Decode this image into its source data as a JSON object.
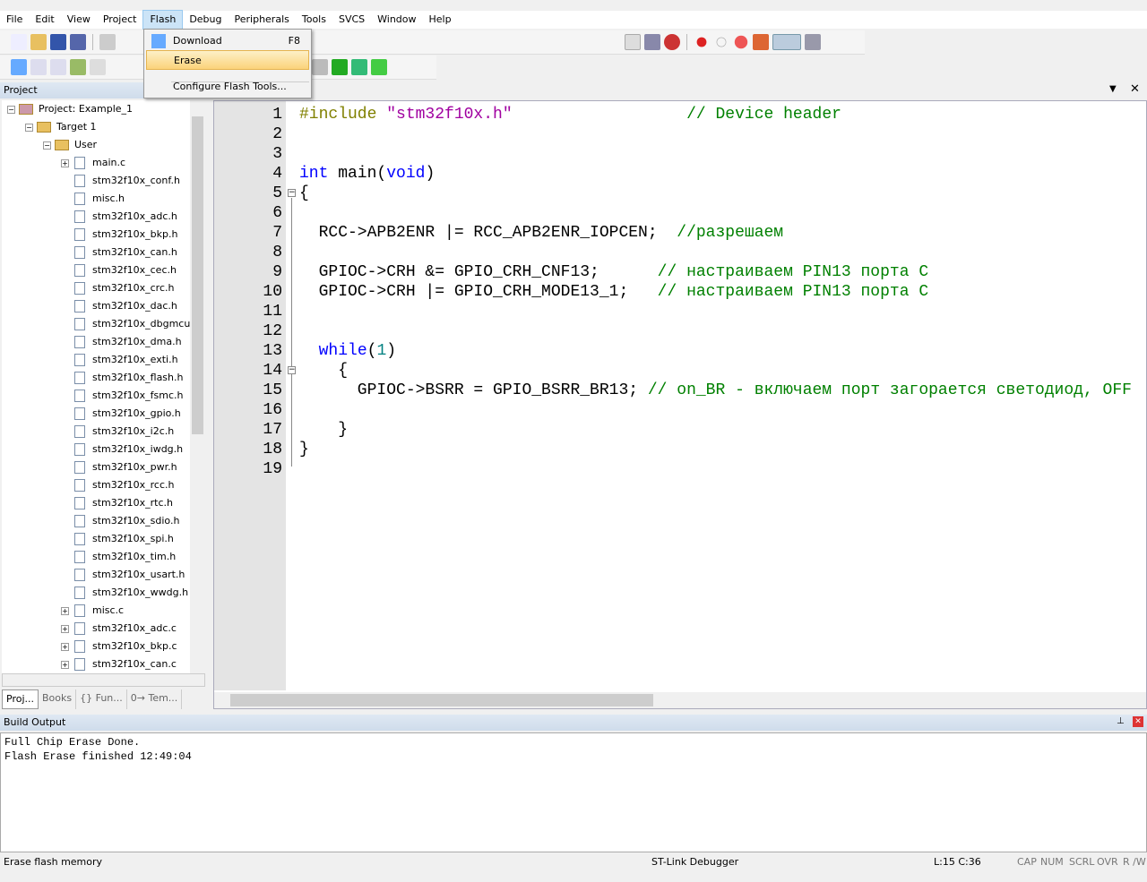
{
  "menubar": [
    "File",
    "Edit",
    "View",
    "Project",
    "Flash",
    "Debug",
    "Peripherals",
    "Tools",
    "SVCS",
    "Window",
    "Help"
  ],
  "flash_menu": {
    "items": [
      {
        "label": "Download",
        "shortcut": "F8",
        "icon": "load-icon"
      },
      {
        "label": "Erase",
        "highlighted": true
      },
      {
        "label": "Configure Flash Tools..."
      }
    ]
  },
  "project_panel": {
    "title": "Project",
    "root": "Project: Example_1",
    "target": "Target 1",
    "group": "User",
    "files": [
      "main.c",
      "stm32f10x_conf.h",
      "misc.h",
      "stm32f10x_adc.h",
      "stm32f10x_bkp.h",
      "stm32f10x_can.h",
      "stm32f10x_cec.h",
      "stm32f10x_crc.h",
      "stm32f10x_dac.h",
      "stm32f10x_dbgmcu.",
      "stm32f10x_dma.h",
      "stm32f10x_exti.h",
      "stm32f10x_flash.h",
      "stm32f10x_fsmc.h",
      "stm32f10x_gpio.h",
      "stm32f10x_i2c.h",
      "stm32f10x_iwdg.h",
      "stm32f10x_pwr.h",
      "stm32f10x_rcc.h",
      "stm32f10x_rtc.h",
      "stm32f10x_sdio.h",
      "stm32f10x_spi.h",
      "stm32f10x_tim.h",
      "stm32f10x_usart.h",
      "stm32f10x_wwdg.h",
      "misc.c",
      "stm32f10x_adc.c",
      "stm32f10x_bkp.c",
      "stm32f10x_can.c"
    ],
    "expandable": [
      0,
      25,
      26,
      27,
      28
    ],
    "tabs": [
      "Proj...",
      "Books",
      "{} Fun...",
      "0→ Tem..."
    ]
  },
  "editor": {
    "lines": [
      [
        [
          "pp",
          "#include "
        ],
        [
          "str",
          "\"stm32f10x.h\""
        ],
        [
          "",
          "                  "
        ],
        [
          "cm",
          "// Device header"
        ]
      ],
      [],
      [],
      [
        [
          "kw",
          "int"
        ],
        [
          "",
          " main("
        ],
        [
          "kw",
          "void"
        ],
        [
          "",
          ")"
        ]
      ],
      [
        [
          "",
          "{"
        ]
      ],
      [],
      [
        [
          "",
          "  RCC->APB2ENR |= RCC_APB2ENR_IOPCEN;  "
        ],
        [
          "cm",
          "//разрешаем"
        ]
      ],
      [],
      [
        [
          "",
          "  GPIOC->CRH &= GPIO_CRH_CNF13;      "
        ],
        [
          "cm",
          "// настраиваем PIN13 порта C"
        ]
      ],
      [
        [
          "",
          "  GPIOC->CRH |= GPIO_CRH_MODE13_1;   "
        ],
        [
          "cm",
          "// настраиваем PIN13 порта C"
        ]
      ],
      [],
      [],
      [
        [
          "",
          "  "
        ],
        [
          "kw",
          "while"
        ],
        [
          "",
          "("
        ],
        [
          "num",
          "1"
        ],
        [
          "",
          ")"
        ]
      ],
      [
        [
          "",
          "    {"
        ]
      ],
      [
        [
          "",
          "      GPIOC->BSRR = GPIO_BSRR_BR13; "
        ],
        [
          "cm",
          "// on_BR - включаем порт загорается светодиод, OFF"
        ]
      ],
      [],
      [
        [
          "",
          "    }"
        ]
      ],
      [
        [
          "",
          "}"
        ]
      ],
      []
    ]
  },
  "build_output": {
    "title": "Build Output",
    "lines": [
      "Full Chip Erase Done.",
      "Flash Erase finished 12:49:04"
    ]
  },
  "status": {
    "message": "Erase flash memory",
    "debugger": "ST-Link Debugger",
    "cursor": "L:15 C:36",
    "indicators": [
      "CAP",
      "NUM",
      "SCRL",
      "OVR",
      "R /W"
    ]
  }
}
